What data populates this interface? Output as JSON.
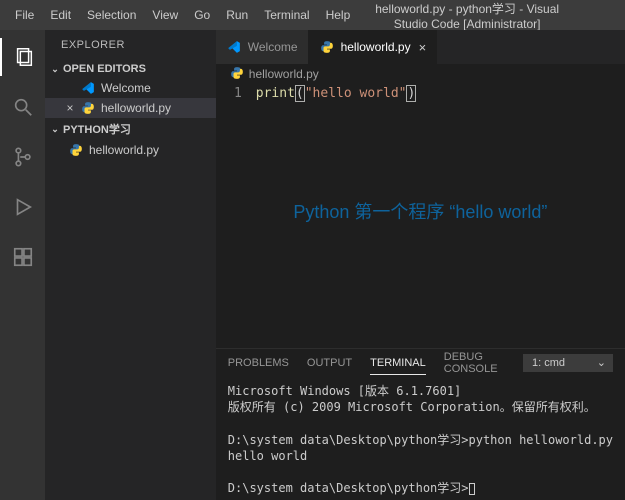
{
  "titlebar": {
    "menus": [
      "File",
      "Edit",
      "Selection",
      "View",
      "Go",
      "Run",
      "Terminal",
      "Help"
    ],
    "title": "helloworld.py - python学习 - Visual Studio Code [Administrator]"
  },
  "sidebar": {
    "title": "EXPLORER",
    "sections": {
      "openEditors": {
        "label": "OPEN EDITORS",
        "items": [
          {
            "label": "Welcome",
            "icon": "vscode-icon",
            "active": false,
            "dirty": false
          },
          {
            "label": "helloworld.py",
            "icon": "python-icon",
            "active": true,
            "dirty": false
          }
        ]
      },
      "workspace": {
        "label": "PYTHON学习",
        "items": [
          {
            "label": "helloworld.py",
            "icon": "python-icon"
          }
        ]
      }
    }
  },
  "activitybar": {
    "items": [
      "explorer",
      "search",
      "source-control",
      "run-debug",
      "extensions"
    ]
  },
  "editor": {
    "tabs": [
      {
        "label": "Welcome",
        "icon": "vscode-icon",
        "active": false
      },
      {
        "label": "helloworld.py",
        "icon": "python-icon",
        "active": true
      }
    ],
    "breadcrumb": {
      "file": "helloworld.py",
      "icon": "python-icon"
    },
    "lines": [
      {
        "num": "1",
        "tokens": {
          "fn": "print",
          "open": "(",
          "str": "\"hello world\"",
          "close": ")"
        }
      }
    ],
    "watermark": "Python 第一个程序 “hello world”"
  },
  "panel": {
    "tabs": [
      "PROBLEMS",
      "OUTPUT",
      "TERMINAL",
      "DEBUG CONSOLE"
    ],
    "activeTab": "TERMINAL",
    "dropdown": "1: cmd",
    "terminal": {
      "line1": "Microsoft Windows [版本 6.1.7601]",
      "line2": "版权所有 (c) 2009 Microsoft Corporation。保留所有权利。",
      "line3": "D:\\system data\\Desktop\\python学习>python helloworld.py",
      "line4": "hello world",
      "line5": "D:\\system data\\Desktop\\python学习>"
    }
  }
}
